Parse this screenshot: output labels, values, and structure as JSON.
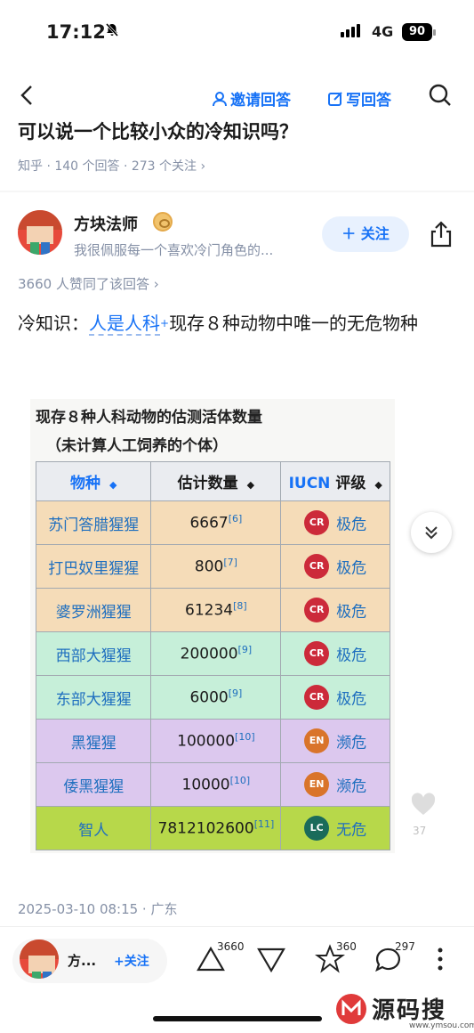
{
  "status_bar": {
    "time": "17:12",
    "network": "4G",
    "battery": "90"
  },
  "nav": {
    "invite_label": "邀请回答",
    "write_label": "写回答"
  },
  "question": {
    "title": "可以说一个比较小众的冷知识吗？",
    "meta": "知乎 · 140 个回答 · 273 个关注 ›"
  },
  "author": {
    "name": "方块法师",
    "bio": "我很佩服每一个喜欢冷门角色的...",
    "follow_label": "＋ 关注"
  },
  "answer": {
    "likes": "3660 人赞同了该回答 ›",
    "text_prefix": "冷知识：",
    "text_kw": "人是人科",
    "text_suffix": "现存８种动物中唯一的无危物种",
    "date": "2025-03-10 08:15 · 广东"
  },
  "table_image": {
    "caption_line1": "现存８种人科动物的估测活体数量",
    "caption_line2": "（未计算人工饲养的个体）",
    "headers": {
      "species": "物种",
      "count": "估计数量",
      "iucn_prefix": "IUCN",
      "iucn_suffix": " 评级"
    },
    "rows": [
      {
        "species": "苏门答腊猩猩",
        "count": "6667",
        "ref": "[6]",
        "code": "CR",
        "status": "极危",
        "bg": "#f5dcb8",
        "code_color": "#cc2a3a"
      },
      {
        "species": "打巴奴里猩猩",
        "count": "800",
        "ref": "[7]",
        "code": "CR",
        "status": "极危",
        "bg": "#f5dcb8",
        "code_color": "#cc2a3a"
      },
      {
        "species": "婆罗洲猩猩",
        "count": "61234",
        "ref": "[8]",
        "code": "CR",
        "status": "极危",
        "bg": "#f5dcb8",
        "code_color": "#cc2a3a"
      },
      {
        "species": "西部大猩猩",
        "count": "200000",
        "ref": "[9]",
        "code": "CR",
        "status": "极危",
        "bg": "#c6efd9",
        "code_color": "#cc2a3a"
      },
      {
        "species": "东部大猩猩",
        "count": "6000",
        "ref": "[9]",
        "code": "CR",
        "status": "极危",
        "bg": "#c6efd9",
        "code_color": "#cc2a3a"
      },
      {
        "species": "黑猩猩",
        "count": "100000",
        "ref": "[10]",
        "code": "EN",
        "status": "濒危",
        "bg": "#dcc8ee",
        "code_color": "#d9742a"
      },
      {
        "species": "倭黑猩猩",
        "count": "10000",
        "ref": "[10]",
        "code": "EN",
        "status": "濒危",
        "bg": "#dcc8ee",
        "code_color": "#d9742a"
      },
      {
        "species": "智人",
        "count": "7812102600",
        "ref": "[11]",
        "code": "LC",
        "status": "无危",
        "bg": "#b7d84a",
        "code_color": "#1a6b5a"
      }
    ]
  },
  "like_float_count": "37",
  "bottom_bar": {
    "name": "方...",
    "follow": "+关注",
    "upvote_count": "3660",
    "star_count": "360",
    "comment_count": "297"
  },
  "watermark": {
    "text": "源码搜",
    "url": "www.ymsou.com"
  }
}
